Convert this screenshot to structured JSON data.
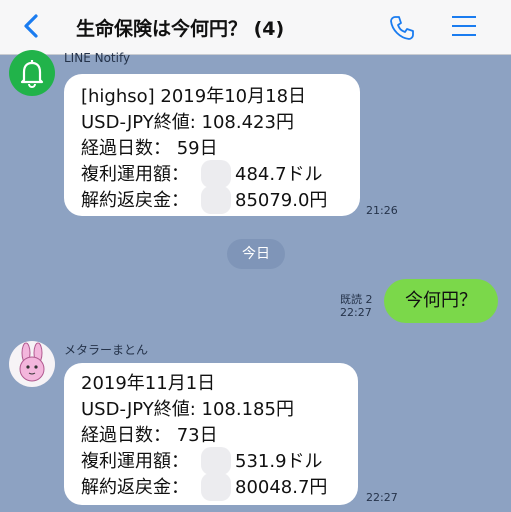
{
  "header": {
    "title": "生命保険は今何円？ (4)"
  },
  "messages": [
    {
      "sender": "LINE Notify",
      "lines": [
        "[highso] 2019年10月18日",
        "USD-JPY終値: 108.423円",
        "経過日数： 59日",
        "複利運用額：",
        "484.7ドル",
        "解約返戻金：",
        "85079.0円"
      ],
      "time": "21:26"
    },
    {
      "sender": "メタラーまとん",
      "lines": [
        "2019年11月1日",
        "USD-JPY終値: 108.185円",
        "経過日数： 73日",
        "複利運用額：",
        "531.9ドル",
        "解約返戻金：",
        "80048.7円"
      ],
      "time": "22:27"
    }
  ],
  "date_separator": "今日",
  "outgoing": {
    "text": "今何円？",
    "read": "既読 2",
    "time": "22:27"
  },
  "colors": {
    "background": "#8da2c2",
    "outgoing_bubble": "#7bd84a",
    "accent": "#1a7cf0"
  },
  "icons": [
    "back-arrow-icon",
    "phone-icon",
    "menu-icon",
    "bell-icon",
    "rabbit-avatar-icon"
  ]
}
